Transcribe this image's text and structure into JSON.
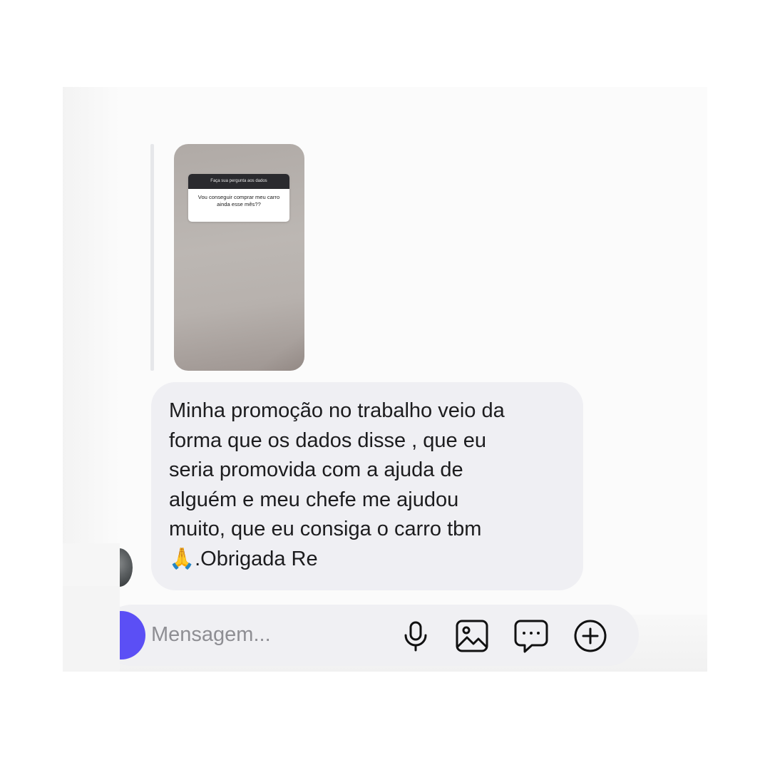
{
  "story_reply": {
    "question_header": "Faça sua pergunta aos dados",
    "question_text": "Vou conseguir comprar meu carro ainda esse mês??"
  },
  "message": {
    "text": "Minha promoção no trabalho veio da\nforma que os dados disse , que eu\nseria promovida com a ajuda de\nalguém e meu chefe me ajudou\nmuito, que eu consiga o carro tbm\n🙏.Obrigada Re"
  },
  "composer": {
    "placeholder": "Mensagem...",
    "icons": [
      "camera-icon",
      "microphone-icon",
      "gallery-icon",
      "sticker-icon",
      "plus-icon"
    ]
  },
  "colors": {
    "accent": "#5b4ff5",
    "bubble": "#efeff3",
    "text": "#1c1c1e",
    "placeholder": "#8e8e93"
  }
}
